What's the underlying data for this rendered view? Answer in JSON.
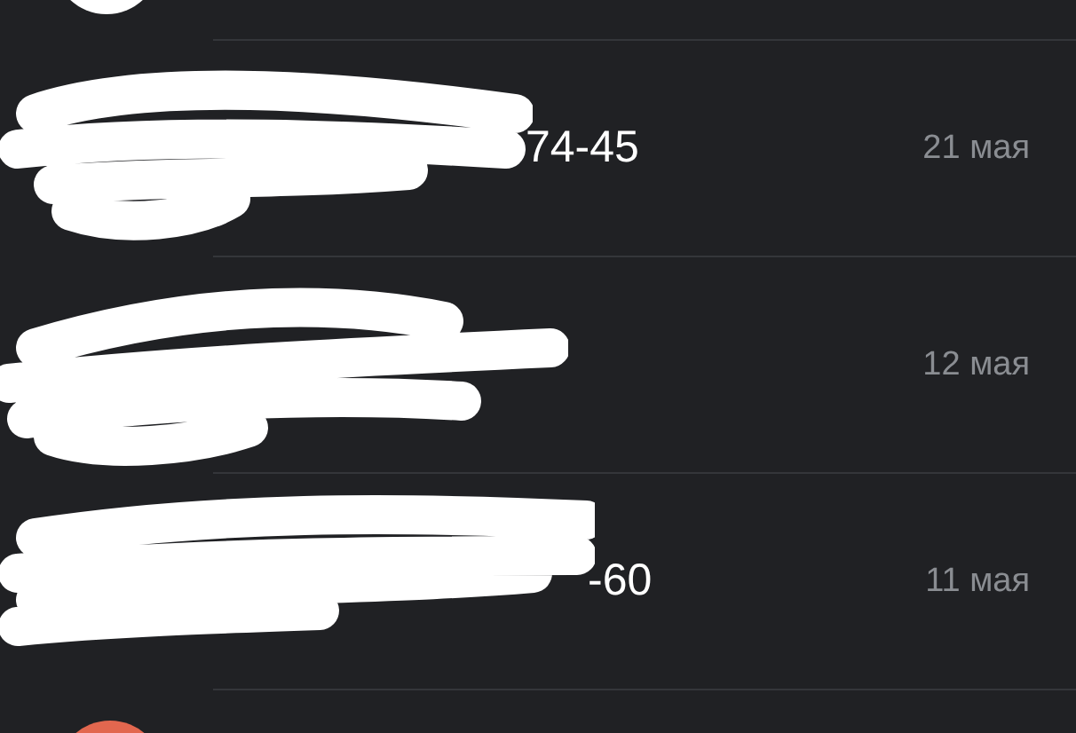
{
  "top_avatar": {
    "color": "#ffffff"
  },
  "calls": [
    {
      "number": "74-45",
      "date": "21 мая"
    },
    {
      "date": "12 мая"
    },
    {
      "number": "-60",
      "date": "11 мая"
    }
  ],
  "bottom_avatar": {
    "color": "#e2674f"
  }
}
